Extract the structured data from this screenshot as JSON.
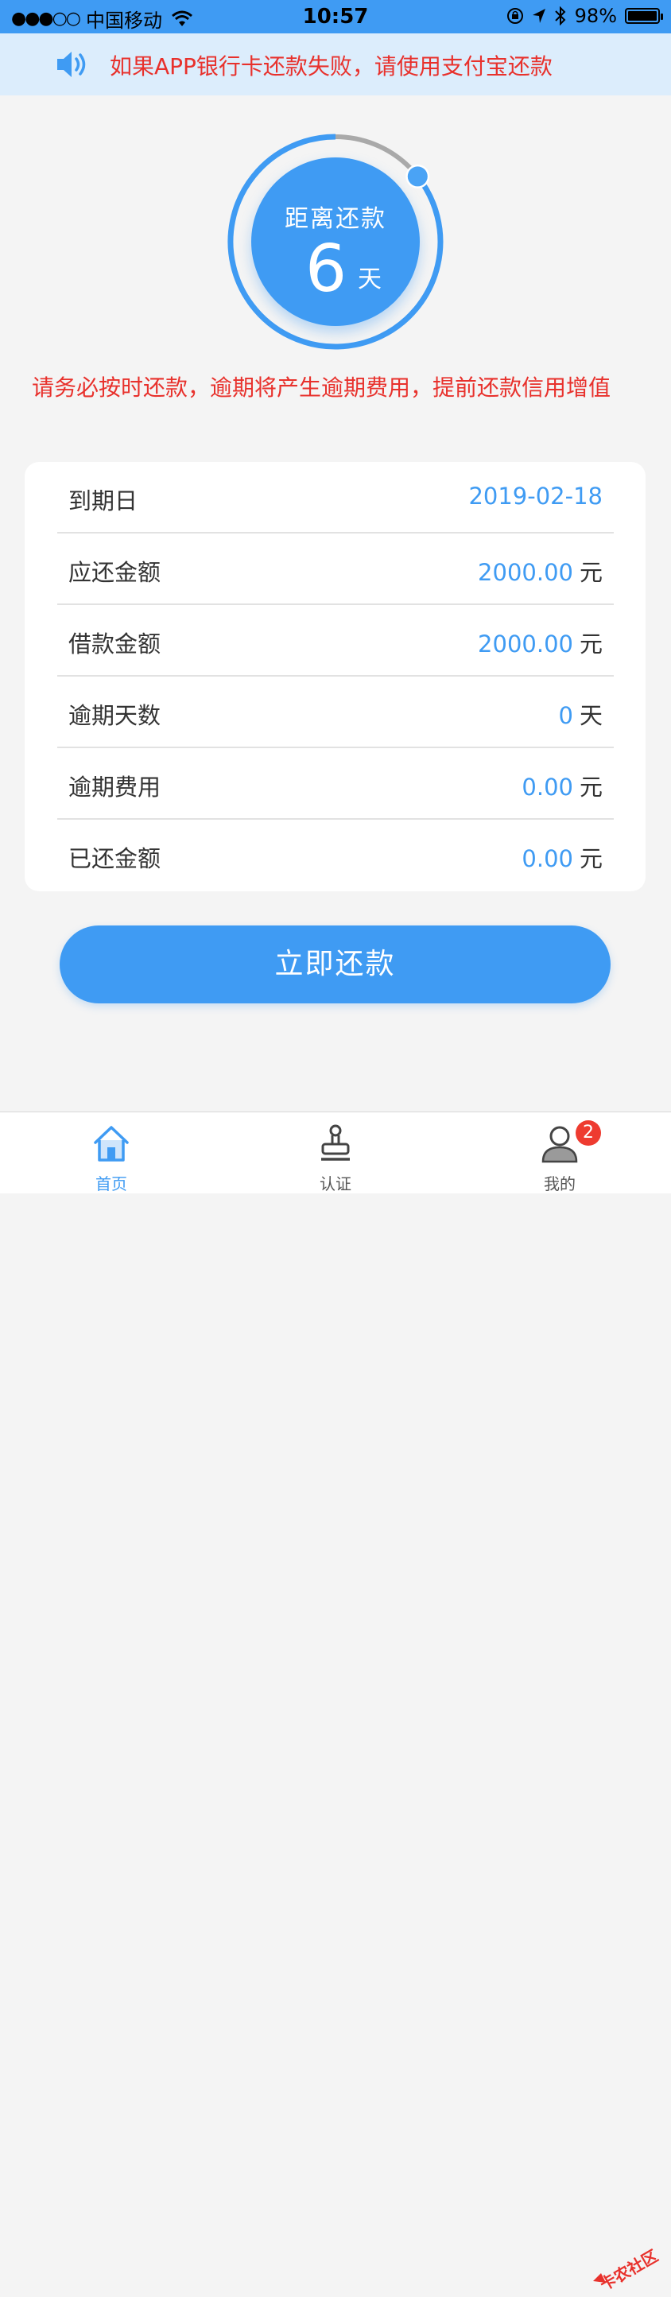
{
  "status_bar": {
    "carrier": "中国移动",
    "time": "10:57",
    "battery": "98%"
  },
  "notice": {
    "text": "如果APP银行卡还款失败，请使用支付宝还款"
  },
  "countdown": {
    "label": "距离还款",
    "days": "6",
    "unit": "天"
  },
  "warning": "请务必按时还款，逾期将产生逾期费用，提前还款信用增值",
  "loan_info": {
    "due_date_label": "到期日",
    "due_date": "2019-02-18",
    "repay_amount_label": "应还金额",
    "repay_amount": "2000.00",
    "repay_amount_unit": "元",
    "loan_amount_label": "借款金额",
    "loan_amount": "2000.00",
    "loan_amount_unit": "元",
    "overdue_days_label": "逾期天数",
    "overdue_days": "0",
    "overdue_days_unit": "天",
    "overdue_fee_label": "逾期费用",
    "overdue_fee": "0.00",
    "overdue_fee_unit": "元",
    "repaid_label": "已还金额",
    "repaid": "0.00",
    "repaid_unit": "元"
  },
  "repay_button": "立即还款",
  "tabs": {
    "home": "首页",
    "auth": "认证",
    "mine": "我的",
    "mine_badge": "2"
  },
  "watermark": "卡农社区",
  "colors": {
    "accent": "#3f9bf3",
    "warning": "#e8312c",
    "notice_bg": "#dcedfc"
  },
  "icons": [
    "signal-icon",
    "wifi-icon",
    "lock-rotation-icon",
    "location-icon",
    "bluetooth-icon",
    "battery-icon",
    "speaker-icon",
    "home-icon",
    "stamp-icon",
    "user-icon"
  ]
}
